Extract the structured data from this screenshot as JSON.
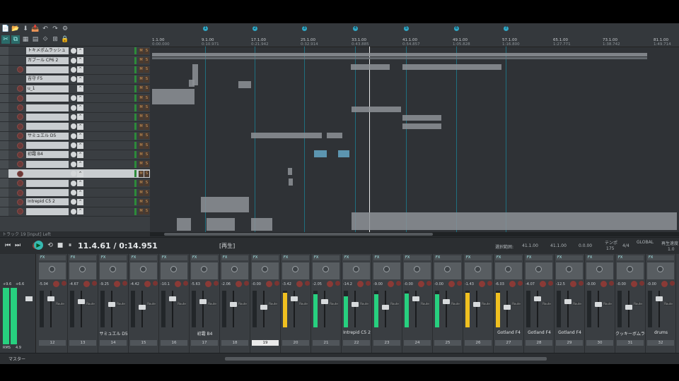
{
  "toolbar": {
    "row1": [
      "📄",
      "📂",
      "⬇",
      "📥",
      "↶",
      "↷",
      "⚙"
    ],
    "row2": [
      "✂",
      "⧉",
      "▦",
      "▤",
      "⟐",
      "⊞",
      "🔒"
    ]
  },
  "tcp": {
    "tracks": [
      {
        "name": "トキメポムラッシュ",
        "rec": false,
        "knob": true
      },
      {
        "name": "ガブール CP6 2",
        "rec": false,
        "knob": true
      },
      {
        "name": "",
        "rec": true,
        "knob": true
      },
      {
        "name": "吉守 F5",
        "rec": false,
        "knob": true
      },
      {
        "name": "u_1",
        "rec": true,
        "knob": false
      },
      {
        "name": "",
        "rec": true,
        "knob": true
      },
      {
        "name": "",
        "rec": true,
        "knob": true
      },
      {
        "name": "",
        "rec": true,
        "knob": true
      },
      {
        "name": "",
        "rec": true,
        "knob": true
      },
      {
        "name": "サミュエル D5",
        "rec": true,
        "knob": true
      },
      {
        "name": "",
        "rec": true,
        "knob": true
      },
      {
        "name": "初霜 B4",
        "rec": true,
        "knob": true
      },
      {
        "name": "",
        "rec": true,
        "knob": true
      },
      {
        "name": "",
        "rec": true,
        "knob": true
      },
      {
        "name": "",
        "rec": true,
        "knob": true
      },
      {
        "name": "",
        "rec": true,
        "knob": true
      },
      {
        "name": "Intrepid C5 2",
        "rec": true,
        "knob": true
      },
      {
        "name": "",
        "rec": true,
        "knob": true
      }
    ],
    "status_text": "トラック 19 [input] Left",
    "mute_label": "M",
    "solo_label": "S"
  },
  "ruler": {
    "markers": [
      "1",
      "2",
      "3",
      "4",
      "5",
      "6",
      "7",
      "8"
    ],
    "ticks": [
      {
        "bar": "1.1.00",
        "time": "0:00.000"
      },
      {
        "bar": "9.1.00",
        "time": "0:10.971"
      },
      {
        "bar": "17.1.00",
        "time": "0:21.942"
      },
      {
        "bar": "25.1.00",
        "time": "0:32.914"
      },
      {
        "bar": "33.1.00",
        "time": "0:43.885"
      },
      {
        "bar": "41.1.00",
        "time": "0:54.857"
      },
      {
        "bar": "49.1.00",
        "time": "1:05.828"
      },
      {
        "bar": "57.1.00",
        "time": "1:16.800"
      },
      {
        "bar": "65.1.00",
        "time": "1:27.771"
      },
      {
        "bar": "73.1.00",
        "time": "1:38.742"
      },
      {
        "bar": "81.1.00",
        "time": "1:49.714"
      }
    ]
  },
  "transport": {
    "position": "11.4.61 / 0:14.951",
    "state": "[再生]",
    "selection_label": "選択範囲:",
    "sel_start": "41.1.00",
    "sel_end": "41.1.00",
    "sel_len": "0.0.00",
    "tempo_label": "テンポ",
    "tempo": "175",
    "timesig": "4/4",
    "rate_label": "再生速度",
    "rate": "1.0",
    "global_label": "GLOBAL"
  },
  "mixer": {
    "master_label": "マスター",
    "master_rms": "RMS",
    "master_val": "4.9",
    "master_top": "+9.6",
    "master_top2": "+6.6",
    "channels": [
      {
        "num": "12",
        "name": "",
        "vol": "-5.04",
        "meter": 0,
        "color": ""
      },
      {
        "num": "13",
        "name": "",
        "vol": "-4.67",
        "meter": 0,
        "color": "",
        "mute": true
      },
      {
        "num": "14",
        "name": "サミュエル D5",
        "vol": "-9.25",
        "meter": 0,
        "color": ""
      },
      {
        "num": "15",
        "name": "",
        "vol": "-4.42",
        "meter": 0,
        "color": ""
      },
      {
        "num": "16",
        "name": "",
        "vol": "-10.1",
        "meter": 0,
        "color": ""
      },
      {
        "num": "17",
        "name": "初霜 B4",
        "vol": "-5.63",
        "meter": 0,
        "color": ""
      },
      {
        "num": "18",
        "name": "",
        "vol": "-2.06",
        "meter": 0,
        "color": ""
      },
      {
        "num": "19",
        "name": "",
        "vol": "-0.00",
        "meter": 0,
        "color": "",
        "sel": true
      },
      {
        "num": "20",
        "name": "",
        "vol": "-3.42",
        "meter": 0.95,
        "color": "#f0c020"
      },
      {
        "num": "21",
        "name": "",
        "vol": "-2.05",
        "meter": 0.9,
        "color": "#27d07f"
      },
      {
        "num": "22",
        "name": "Intrepid C5 2",
        "vol": "-14.2",
        "meter": 0.85,
        "color": "#27d07f"
      },
      {
        "num": "23",
        "name": "",
        "vol": "-9.00",
        "meter": 0.9,
        "color": "#27d07f"
      },
      {
        "num": "24",
        "name": "",
        "vol": "-0.00",
        "meter": 0.92,
        "color": "#27d07f"
      },
      {
        "num": "25",
        "name": "",
        "vol": "-0.00",
        "meter": 0.9,
        "color": "#27d07f"
      },
      {
        "num": "26",
        "name": "",
        "vol": "-1.43",
        "meter": 0.95,
        "color": "#f0c020"
      },
      {
        "num": "27",
        "name": "Gotland F4",
        "vol": "-6.03",
        "meter": 0.95,
        "color": "#f0c020"
      },
      {
        "num": "28",
        "name": "Gotland F4",
        "vol": "-4.07",
        "meter": 0,
        "color": ""
      },
      {
        "num": "29",
        "name": "Gotland F4",
        "vol": "-12.5",
        "meter": 0,
        "color": ""
      },
      {
        "num": "30",
        "name": "",
        "vol": "-0.00",
        "meter": 0,
        "color": ""
      },
      {
        "num": "31",
        "name": "クッキーボムラッシ",
        "vol": "-0.00",
        "meter": 0,
        "color": ""
      },
      {
        "num": "32",
        "name": "drums",
        "vol": "-0.00",
        "meter": 0,
        "color": ""
      }
    ],
    "fx_label": "FX",
    "route_label": "Route"
  }
}
